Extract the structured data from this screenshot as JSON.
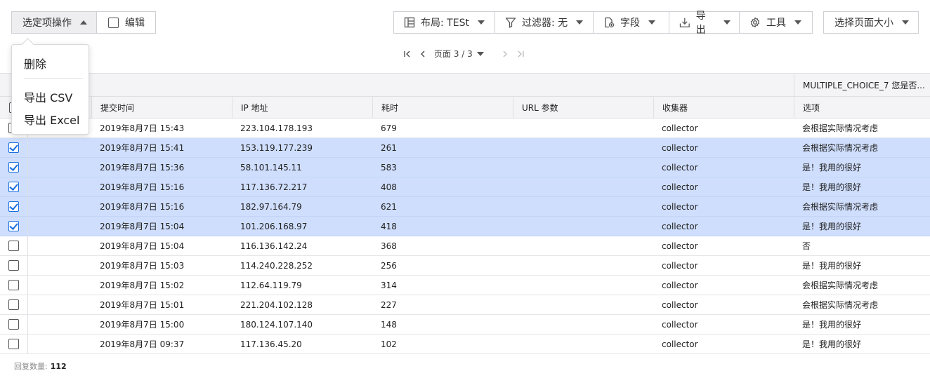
{
  "toolbar": {
    "selection_actions_label": "选定项操作",
    "edit_label": "编辑",
    "layout_label": "布局: TESt",
    "filter_label": "过滤器: 无",
    "fields_label": "字段",
    "export_label": "导出",
    "tools_label": "工具",
    "page_size_label": "选择页面大小"
  },
  "pager": {
    "label": "页面 3 / 3"
  },
  "dropdown": {
    "items": [
      "删除",
      "导出 CSV",
      "导出 Excel"
    ]
  },
  "table": {
    "group_header": "MULTIPLE_CHOICE_7 您是否...",
    "columns": [
      "提交时间",
      "IP 地址",
      "耗时",
      "URL 参数",
      "收集器",
      "选项"
    ],
    "rows": [
      {
        "time": "2019年8月7日 15:43",
        "ip": "223.104.178.193",
        "duration": "679",
        "url": "",
        "collector": "collector",
        "option": "会根据实际情况考虑",
        "selected": false
      },
      {
        "time": "2019年8月7日 15:41",
        "ip": "153.119.177.239",
        "duration": "261",
        "url": "",
        "collector": "collector",
        "option": "会根据实际情况考虑",
        "selected": true
      },
      {
        "time": "2019年8月7日 15:36",
        "ip": "58.101.145.11",
        "duration": "583",
        "url": "",
        "collector": "collector",
        "option": "是！我用的很好",
        "selected": true
      },
      {
        "time": "2019年8月7日 15:16",
        "ip": "117.136.72.217",
        "duration": "408",
        "url": "",
        "collector": "collector",
        "option": "是！我用的很好",
        "selected": true
      },
      {
        "time": "2019年8月7日 15:16",
        "ip": "182.97.164.79",
        "duration": "621",
        "url": "",
        "collector": "collector",
        "option": "会根据实际情况考虑",
        "selected": true
      },
      {
        "time": "2019年8月7日 15:04",
        "ip": "101.206.168.97",
        "duration": "418",
        "url": "",
        "collector": "collector",
        "option": "是！我用的很好",
        "selected": true
      },
      {
        "time": "2019年8月7日 15:04",
        "ip": "116.136.142.24",
        "duration": "368",
        "url": "",
        "collector": "collector",
        "option": "否",
        "selected": false
      },
      {
        "time": "2019年8月7日 15:03",
        "ip": "114.240.228.252",
        "duration": "256",
        "url": "",
        "collector": "collector",
        "option": "是！我用的很好",
        "selected": false
      },
      {
        "time": "2019年8月7日 15:02",
        "ip": "112.64.119.79",
        "duration": "314",
        "url": "",
        "collector": "collector",
        "option": "会根据实际情况考虑",
        "selected": false
      },
      {
        "time": "2019年8月7日 15:01",
        "ip": "221.204.102.128",
        "duration": "227",
        "url": "",
        "collector": "collector",
        "option": "会根据实际情况考虑",
        "selected": false
      },
      {
        "time": "2019年8月7日 15:00",
        "ip": "180.124.107.140",
        "duration": "148",
        "url": "",
        "collector": "collector",
        "option": "是！我用的很好",
        "selected": false
      },
      {
        "time": "2019年8月7日 09:37",
        "ip": "117.136.45.20",
        "duration": "102",
        "url": "",
        "collector": "collector",
        "option": "是！我用的很好",
        "selected": false
      }
    ]
  },
  "footer": {
    "label": "回复数量:",
    "count": "112"
  },
  "colors": {
    "selected_row": "#cfdefd",
    "checkbox_accent": "#1a6fe0",
    "header_bg": "#f4f4f6"
  },
  "icons": [
    "caret-up-icon",
    "checkbox-icon",
    "layout-icon",
    "filter-icon",
    "add-field-icon",
    "download-icon",
    "gear-icon",
    "caret-down-icon",
    "first-page-icon",
    "prev-page-icon",
    "next-page-icon",
    "last-page-icon"
  ]
}
